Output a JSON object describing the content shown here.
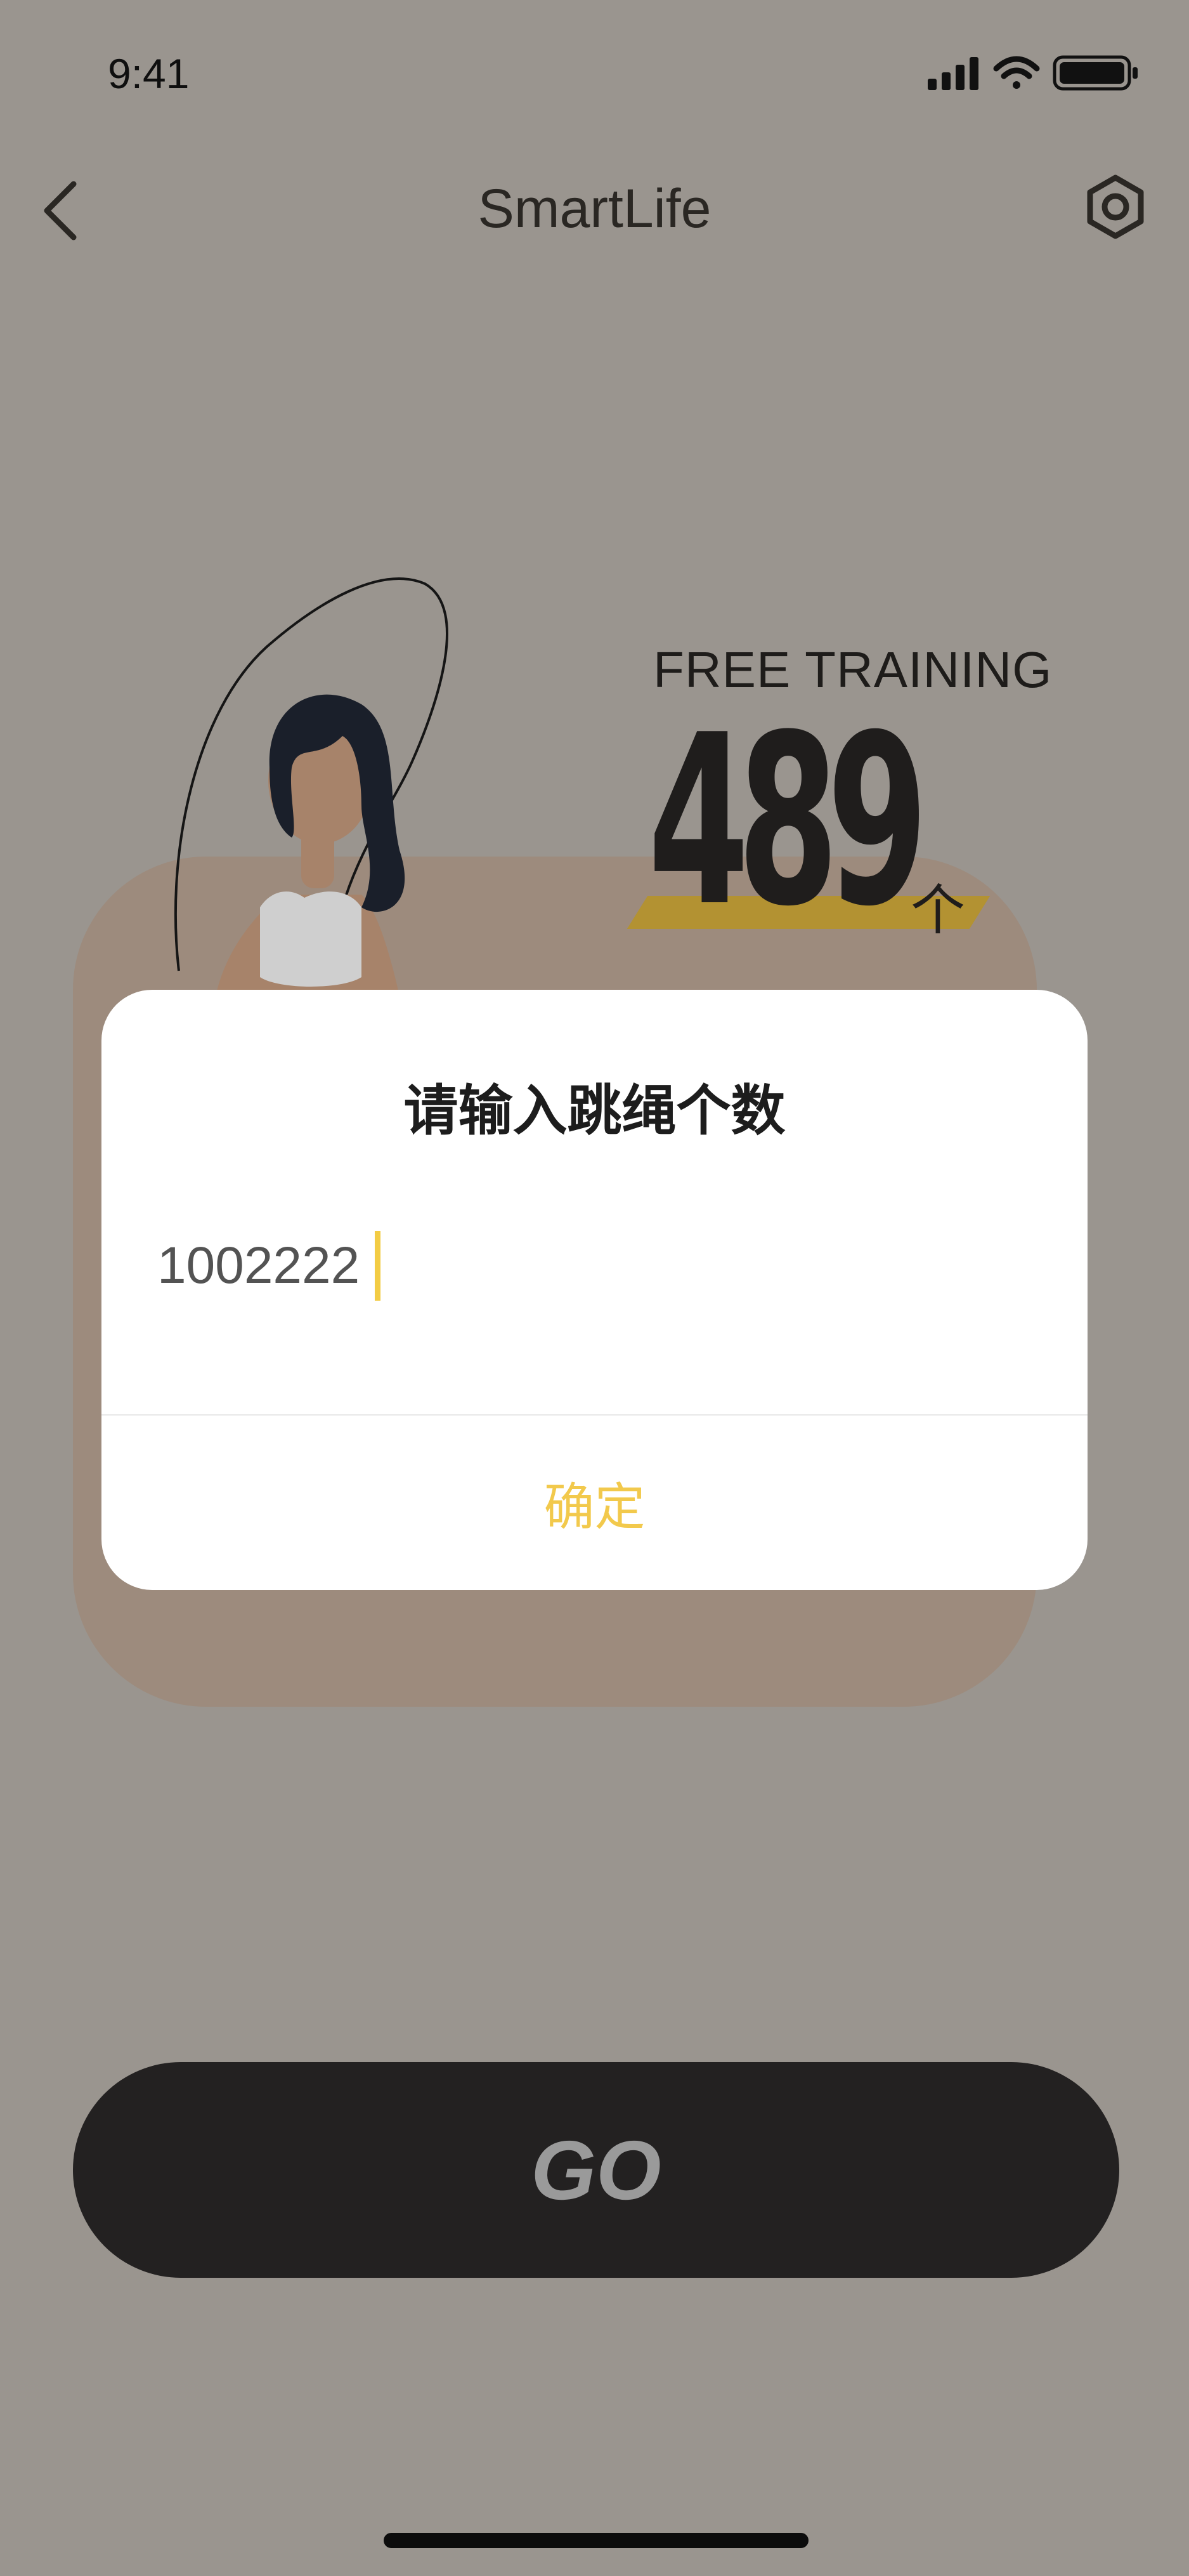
{
  "status_bar": {
    "time": "9:41"
  },
  "nav": {
    "title": "SmartLife",
    "back_icon": "chevron-left-icon",
    "settings_icon": "hexagon-settings-icon"
  },
  "training": {
    "mode_label": "FREE TRAINING",
    "count": "489",
    "unit": "个"
  },
  "dialog": {
    "title": "请输入跳绳个数",
    "input_value": "1002222",
    "confirm_label": "确定",
    "accent_color": "#f2c94c"
  },
  "go_button": {
    "label": "GO"
  },
  "colors": {
    "overlay_bg": "#9a958f",
    "card_bg": "#9d8b7d",
    "count_band": "#b39232",
    "go_bg": "#232121"
  }
}
